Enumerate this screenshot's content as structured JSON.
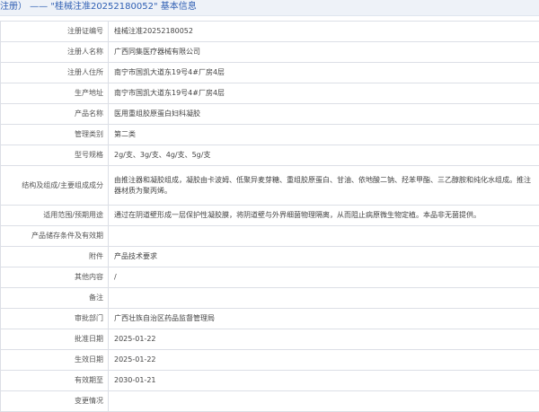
{
  "header": {
    "title": "注册）  ——  \"桂械注准20252180052\"  基本信息"
  },
  "rows": [
    {
      "label": "注册证编号",
      "value": "桂械注准20252180052"
    },
    {
      "label": "注册人名称",
      "value": "广西同集医疗器械有限公司"
    },
    {
      "label": "注册人住所",
      "value": "南宁市国凯大道东19号4#厂房4层"
    },
    {
      "label": "生产地址",
      "value": "南宁市国凯大道东19号4#厂房4层"
    },
    {
      "label": "产品名称",
      "value": "医用重组胶原蛋白妇科凝胶"
    },
    {
      "label": "管理类别",
      "value": "第二类"
    },
    {
      "label": "型号规格",
      "value": "2g/支、3g/支、4g/支、5g/支"
    },
    {
      "label": "结构及组成/主要组成成分",
      "value": "由推注器和凝胶组成，凝胶由卡波姆、低聚异麦芽糖、重组胶原蛋白、甘油、依地酸二钠、羟苯甲酯、三乙醇胺和纯化水组成。推注器材质为聚丙烯。"
    },
    {
      "label": "适用范围/预期用途",
      "value": "通过在阴道壁形成一层保护性凝胶膜，将阴道壁与外界细菌物理隔离，从而阻止病原微生物定植。本品非无菌提供。"
    },
    {
      "label": "产品储存条件及有效期",
      "value": ""
    },
    {
      "label": "附件",
      "value": "产品技术要求"
    },
    {
      "label": "其他内容",
      "value": "/"
    },
    {
      "label": "备注",
      "value": ""
    },
    {
      "label": "审批部门",
      "value": "广西壮族自治区药品监督管理局"
    },
    {
      "label": "批准日期",
      "value": "2025-01-22"
    },
    {
      "label": "生效日期",
      "value": "2025-01-22"
    },
    {
      "label": "有效期至",
      "value": "2030-01-21"
    },
    {
      "label": "变更情况",
      "value": ""
    }
  ],
  "colors": {
    "title": "#2f5fb3",
    "border": "#dcdfe6",
    "header_bg": "#eef2f8"
  }
}
